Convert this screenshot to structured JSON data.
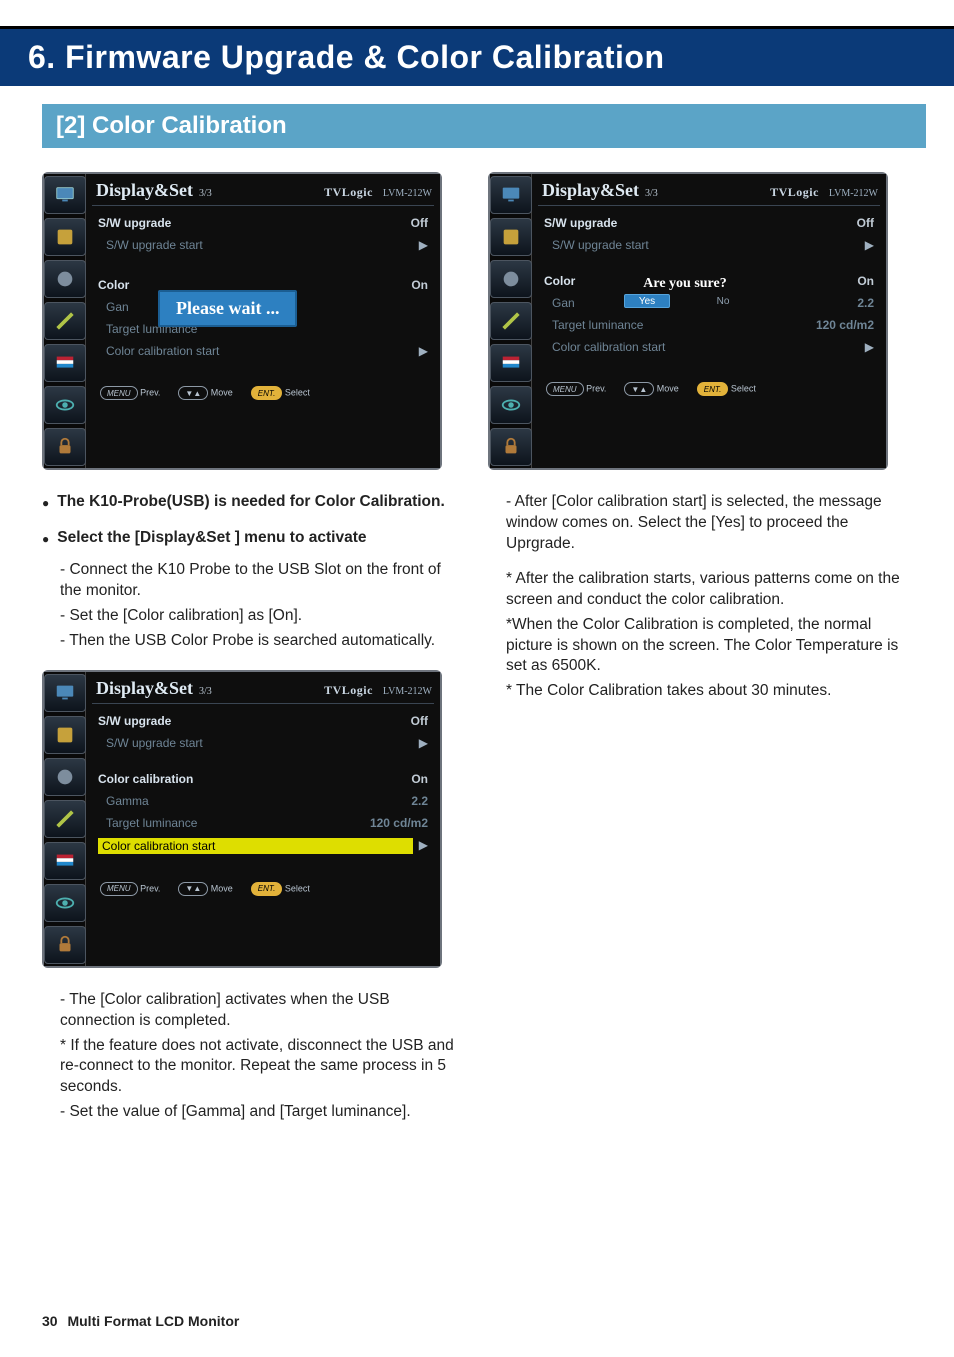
{
  "chapter_title": "6. Firmware Upgrade  &  Color Calibration",
  "section_title": "[2] Color Calibration",
  "osd_common": {
    "title_main": "Display&Set",
    "title_sub": "3/3",
    "brand": "TVLogic",
    "model": "LVM-212W",
    "footer_prev_pill": "MENU",
    "footer_prev_label": "Prev.",
    "footer_move_pill": "▼▲",
    "footer_move_label": "Move",
    "footer_select_pill": "ENT.",
    "footer_select_label": "Select"
  },
  "osd1": {
    "sw_upgrade_label": "S/W upgrade",
    "sw_upgrade_value": "Off",
    "sw_upgrade_start": "S/W upgrade start",
    "color_label_prefix": "Color",
    "gan_prefix": "Gan",
    "wait_text": "Please wait ...",
    "color_value": "On",
    "target_luminance_label": "Target luminance",
    "color_cal_start_label": "Color calibration start"
  },
  "osd2": {
    "sw_upgrade_label": "S/W upgrade",
    "sw_upgrade_value": "Off",
    "sw_upgrade_start": "S/W upgrade start",
    "color_cal_label": "Color calibration",
    "color_cal_value": "On",
    "gamma_label": "Gamma",
    "gamma_value": "2.2",
    "target_luminance_label": "Target luminance",
    "target_luminance_value": "120 cd/m2",
    "color_cal_start_label": "Color calibration start"
  },
  "osd3": {
    "sw_upgrade_label": "S/W upgrade",
    "sw_upgrade_value": "Off",
    "sw_upgrade_start": "S/W upgrade start",
    "color_label_prefix": "Color",
    "gan_prefix": "Gan",
    "sure_text": "Are you sure?",
    "yes_label": "Yes",
    "no_label": "No",
    "color_value": "On",
    "gamma_value_suffix": "2.2",
    "target_luminance_label": "Target luminance",
    "target_luminance_value": "120 cd/m2",
    "color_cal_start_label": "Color calibration start"
  },
  "left_text": {
    "b1": "The K10-Probe(USB) is needed for Color Calibration.",
    "b2": "Select the [Display&Set ] menu to activate",
    "p1": "- Connect the K10 Probe to the USB Slot on the front of the monitor.",
    "p2": "- Set the [Color calibration] as [On].",
    "p3": "- Then the USB Color Probe is searched automatically.",
    "p4": "- The [Color calibration] activates when the USB connection is completed.",
    "p5": "* If the feature does not activate, disconnect the USB and re-connect to the monitor. Repeat the same process in 5 seconds.",
    "p6": "- Set the value of [Gamma] and [Target luminance]."
  },
  "right_text": {
    "p1": "- After [Color calibration start] is selected, the message window comes on. Select the [Yes] to proceed the Uprgrade.",
    "p2": "* After the calibration starts, various patterns come on the screen and conduct the color calibration.",
    "p3": "*When the Color Calibration is completed, the normal picture is shown on the screen. The Color Temperature is set as 6500K.",
    "p4": "* The Color Calibration takes about 30 minutes."
  },
  "footer": {
    "page_num": "30",
    "doc_title": "Multi Format LCD Monitor"
  }
}
